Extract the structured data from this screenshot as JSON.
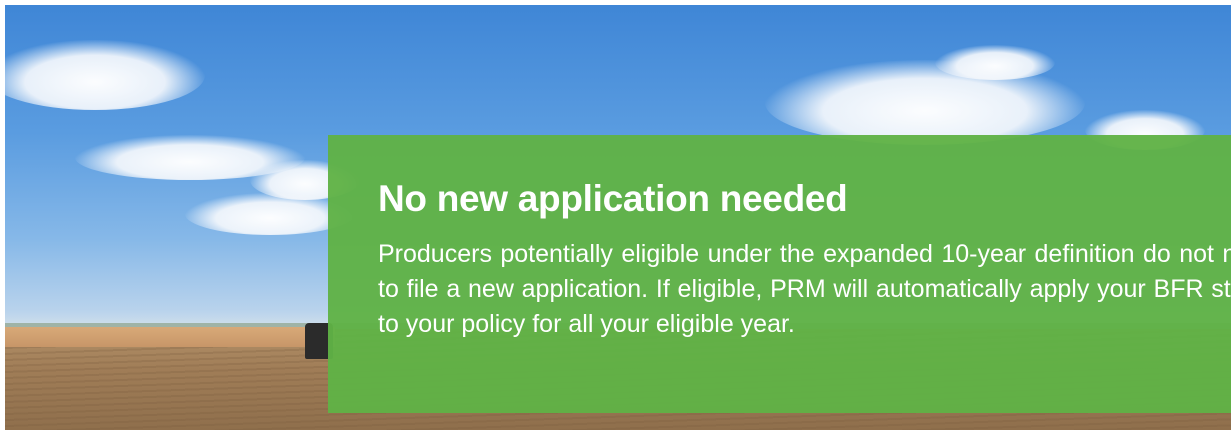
{
  "hero": {
    "image_label": "farm-field-with-sky",
    "overlay_color": "#60b246",
    "title": "No new application needed",
    "body": "Producers potentially eligible under the expanded 10-year definition do not need to file a new application. If eligible, PRM will automatically apply your BFR status to your policy for all your eligible year."
  }
}
